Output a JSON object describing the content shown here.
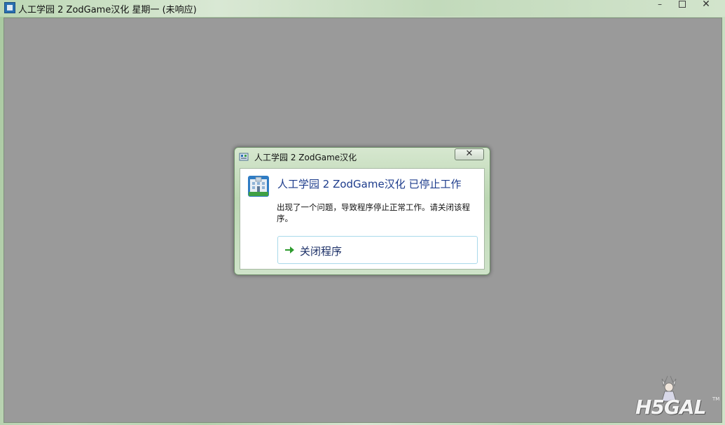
{
  "window": {
    "title": "人工学园 2  ZodGame汉化 星期一 (未响应)",
    "minimize_glyph": "–",
    "close_glyph": "✕"
  },
  "dialog": {
    "title": "人工学园 2  ZodGame汉化",
    "close_glyph": "✕",
    "main_message": "人工学园 2  ZodGame汉化 已停止工作",
    "sub_message": "出现了一个问题，导致程序停止正常工作。请关闭该程序。",
    "action_label": "关闭程序"
  },
  "watermark": {
    "logo_text": "H5GAL",
    "trademark": "TM"
  },
  "colors": {
    "client_gray": "#9a9a9a",
    "frame_green": "#bcd7b4",
    "main_message_blue": "#1d3c8c",
    "action_border": "#a9d9ea",
    "arrow_green": "#2e9b2e"
  },
  "icons": {
    "app": "app-window-icon",
    "dialog": "app-small-icon",
    "program": "program-building-icon",
    "action": "green-arrow-icon"
  }
}
